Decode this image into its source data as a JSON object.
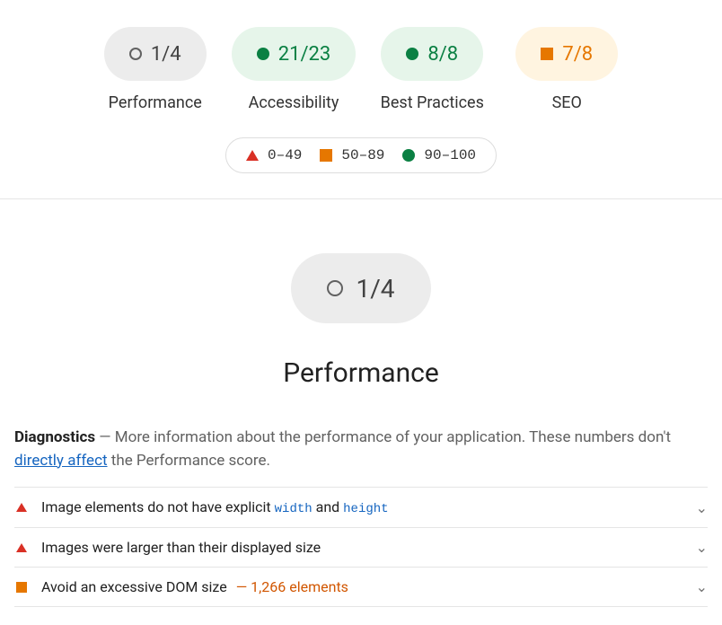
{
  "gauges": [
    {
      "score": "1/4",
      "label": "Performance",
      "style": "null"
    },
    {
      "score": "21/23",
      "label": "Accessibility",
      "style": "pass"
    },
    {
      "score": "8/8",
      "label": "Best Practices",
      "style": "pass"
    },
    {
      "score": "7/8",
      "label": "SEO",
      "style": "avg"
    }
  ],
  "legend": {
    "fail": "0–49",
    "avg": "50–89",
    "pass": "90–100"
  },
  "section": {
    "score": "1/4",
    "title": "Performance"
  },
  "diagnostics": {
    "label": "Diagnostics",
    "sep": " — ",
    "lead": "More information about the performance of your application. These numbers don't ",
    "link": "directly affect",
    "tail": " the Performance score."
  },
  "audits": [
    {
      "severity": "fail",
      "text_pre": "Image elements do not have explicit ",
      "code1": "width",
      "mid": " and ",
      "code2": "height",
      "value": ""
    },
    {
      "severity": "fail",
      "text_pre": "Images were larger than their displayed size",
      "code1": "",
      "mid": "",
      "code2": "",
      "value": ""
    },
    {
      "severity": "avg",
      "text_pre": "Avoid an excessive DOM size",
      "code1": "",
      "mid": "",
      "code2": "",
      "value": "— 1,266 elements"
    }
  ]
}
